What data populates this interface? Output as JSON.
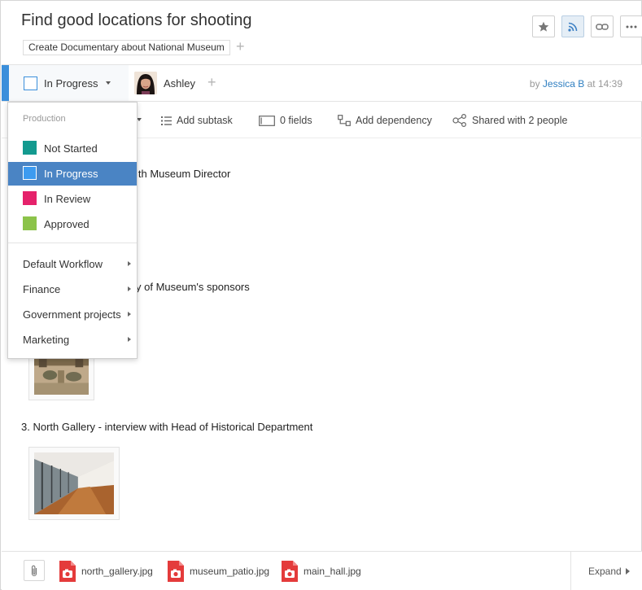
{
  "header": {
    "title": "Find good locations for shooting",
    "parent_folder": "Create Documentary about National Museum",
    "add_parent_symbol": "+",
    "buttons": [
      {
        "name": "star-button",
        "icon": "star-icon"
      },
      {
        "name": "follow-button",
        "icon": "rss-icon"
      },
      {
        "name": "link-button",
        "icon": "link-icon"
      },
      {
        "name": "more-button",
        "icon": "more-icon"
      }
    ]
  },
  "status_bar": {
    "status": "In Progress",
    "status_color": "#3b8fdb",
    "assignee": "Ashley",
    "add_assignee_symbol": "+",
    "by_prefix": "by",
    "author": "Jessica B",
    "time": "at 14:39"
  },
  "toolbar": {
    "add_subtask": "Add subtask",
    "fields": "0 fields",
    "add_dependency": "Add dependency",
    "shared": "Shared with 2 people"
  },
  "body": {
    "line1": "ith Museum Director",
    "line2": "y of Museum's sponsors",
    "line3": "3. North Gallery - interview with Head of Historical Department"
  },
  "status_dropdown": {
    "heading": "Production",
    "statuses": [
      {
        "label": "Not Started",
        "color": "#139a8f"
      },
      {
        "label": "In Progress",
        "color": "#3d9bf0",
        "selected": true
      },
      {
        "label": "In Review",
        "color": "#e5226b"
      },
      {
        "label": "Approved",
        "color": "#8cc34a"
      }
    ],
    "workflows": [
      "Default Workflow",
      "Finance",
      "Government projects",
      "Marketing"
    ]
  },
  "footer": {
    "attachments": [
      "north_gallery.jpg",
      "museum_patio.jpg",
      "main_hall.jpg"
    ],
    "expand_label": "Expand"
  }
}
